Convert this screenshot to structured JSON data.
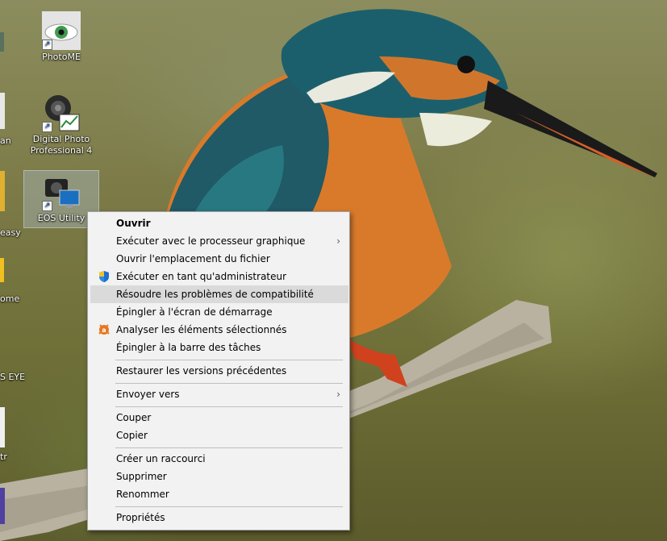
{
  "desktop": {
    "icons": [
      {
        "label": "PhotoME"
      },
      {
        "label": "Digital Photo Professional 4"
      },
      {
        "label": "EOS Utility"
      }
    ],
    "edge_labels": [
      "an",
      "easy",
      "ome",
      "S EYE",
      "tr"
    ]
  },
  "context_menu": {
    "items": [
      {
        "label": "Ouvrir"
      },
      {
        "label": "Exécuter avec le processeur graphique"
      },
      {
        "label": "Ouvrir l'emplacement du fichier"
      },
      {
        "label": "Exécuter en tant qu'administrateur",
        "icon": "uac-shield-icon"
      },
      {
        "label": "Résoudre les problèmes de compatibilité"
      },
      {
        "label": "Épingler à l'écran de démarrage"
      },
      {
        "label": "Analyser les éléments sélectionnés",
        "icon": "avast-icon"
      },
      {
        "label": "Épingler à la barre des tâches"
      },
      {
        "label": "Restaurer les versions précédentes"
      },
      {
        "label": "Envoyer vers"
      },
      {
        "label": "Couper"
      },
      {
        "label": "Copier"
      },
      {
        "label": "Créer un raccourci"
      },
      {
        "label": "Supprimer"
      },
      {
        "label": "Renommer"
      },
      {
        "label": "Propriétés"
      }
    ],
    "submenu_arrow": "›"
  },
  "colors": {
    "menu_bg": "#f2f2f2",
    "menu_highlight": "#dadada",
    "accent_orange": "#e87722"
  }
}
